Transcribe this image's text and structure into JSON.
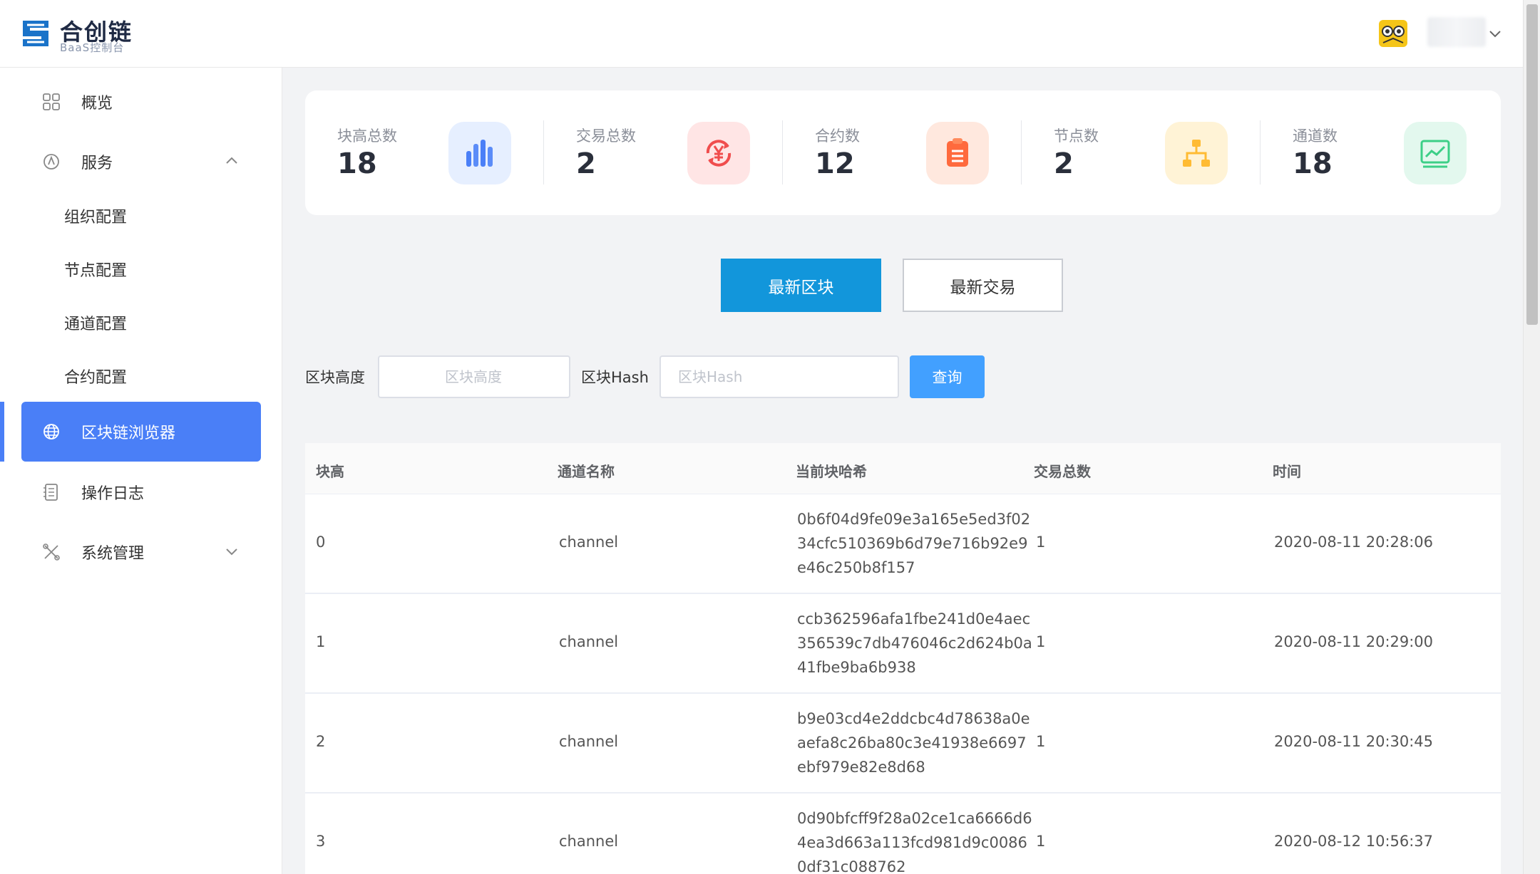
{
  "header": {
    "logo_title": "合创链",
    "logo_subtitle": "BaaS控制台",
    "avatar_icon": "owl-avatar-icon",
    "user_menu_icon": "chevron-down-icon"
  },
  "sidebar": {
    "items": [
      {
        "label": "概览",
        "icon": "grid-icon"
      },
      {
        "label": "服务",
        "icon": "service-icon"
      },
      {
        "label": "组织配置"
      },
      {
        "label": "节点配置"
      },
      {
        "label": "通道配置"
      },
      {
        "label": "合约配置"
      },
      {
        "label": "区块链浏览器",
        "icon": "globe-icon",
        "active": true
      },
      {
        "label": "操作日志",
        "icon": "log-icon"
      },
      {
        "label": "系统管理",
        "icon": "tools-icon"
      }
    ]
  },
  "stats": [
    {
      "label": "块高总数",
      "value": "18",
      "icon": "bar-chart-icon",
      "color": "#4a7ff7",
      "bg": "#e6efff"
    },
    {
      "label": "交易总数",
      "value": "2",
      "icon": "yen-exchange-icon",
      "color": "#f04d4d",
      "bg": "#ffe5e5"
    },
    {
      "label": "合约数",
      "value": "12",
      "icon": "clipboard-icon",
      "color": "#ff6a3d",
      "bg": "#ffe8de"
    },
    {
      "label": "节点数",
      "value": "2",
      "icon": "org-tree-icon",
      "color": "#ffbb33",
      "bg": "#fff3d6"
    },
    {
      "label": "通道数",
      "value": "18",
      "icon": "trend-chart-icon",
      "color": "#3ccf87",
      "bg": "#e3f8ee"
    }
  ],
  "tabs": {
    "latest_blocks": "最新区块",
    "latest_transactions": "最新交易"
  },
  "search": {
    "height_label": "区块高度",
    "height_placeholder": "区块高度",
    "hash_label": "区块Hash",
    "hash_placeholder": "区块Hash",
    "query_button": "查询"
  },
  "table": {
    "columns": [
      "块高",
      "通道名称",
      "当前块哈希",
      "交易总数",
      "时间"
    ],
    "rows": [
      {
        "height": "0",
        "channel": "channel",
        "hash": "0b6f04d9fe09e3a165e5ed3f0234cfc510369b6d79e716b92e9e46c250b8f157",
        "tx_count": "1",
        "time": "2020-08-11 20:28:06"
      },
      {
        "height": "1",
        "channel": "channel",
        "hash": "ccb362596afa1fbe241d0e4aec356539c7db476046c2d624b0a41fbe9ba6b938",
        "tx_count": "1",
        "time": "2020-08-11 20:29:00"
      },
      {
        "height": "2",
        "channel": "channel",
        "hash": "b9e03cd4e2ddcbc4d78638a0eaefa8c26ba80c3e41938e6697ebf979e82e8d68",
        "tx_count": "1",
        "time": "2020-08-11 20:30:45"
      },
      {
        "height": "3",
        "channel": "channel",
        "hash": "0d90bfcff9f28a02ce1ca6666d64ea3d663a113fcd981d9c00860df31c088762",
        "tx_count": "1",
        "time": "2020-08-12 10:56:37"
      }
    ]
  }
}
